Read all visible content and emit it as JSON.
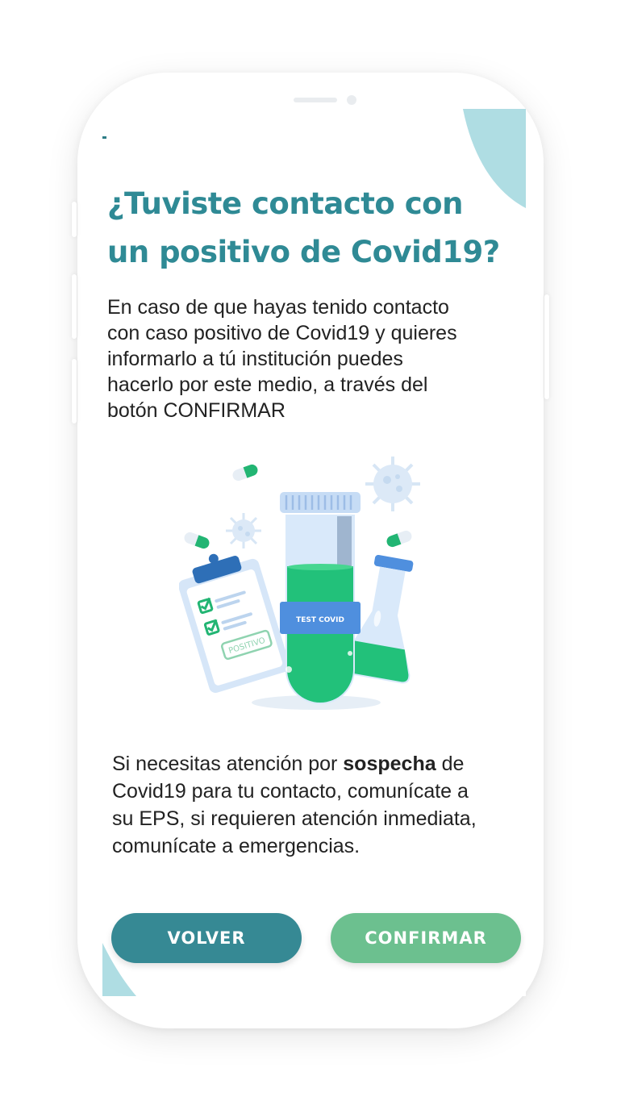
{
  "title": {
    "line1": "¿Tuviste contacto con",
    "line2": "un positivo de  Covid19?"
  },
  "intro": {
    "line1": "En caso de que hayas tenido contacto",
    "line2": "con caso positivo de Covid19 y quieres",
    "line3": "informarlo a tú institución puedes",
    "line4": "hacerlo por este medio, a través del",
    "line5": "botón CONFIRMAR"
  },
  "illustration": {
    "tube_label": "TEST COVID",
    "stamp": "POSITIVO"
  },
  "notice": {
    "l1_a": "Si necesitas atención por ",
    "l1_bold": "sospecha",
    "l1_b": " de",
    "line2": "Covid19 para tu contacto, comunícate a",
    "line3": "su EPS, si requieren atención inmediata,",
    "line4": "comunícate a emergencias."
  },
  "buttons": {
    "back": "VOLVER",
    "confirm": "CONFIRMAR"
  },
  "colors": {
    "title": "#2f8a95",
    "back_button": "#368994",
    "confirm_button": "#6cc08f",
    "decor_blob": "#afdde3"
  }
}
